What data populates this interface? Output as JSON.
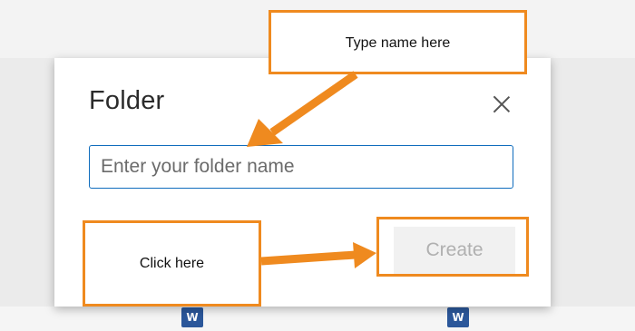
{
  "dialog": {
    "title": "Folder",
    "input_placeholder": "Enter your folder name",
    "input_value": "",
    "create_label": "Create"
  },
  "annotations": {
    "top_callout": "Type name here",
    "left_callout": "Click here"
  },
  "background": {
    "file_icon_letter": "W"
  },
  "colors": {
    "annotation_orange": "#ef8a1f",
    "input_border": "#0f6cbd",
    "word_blue": "#2b579a"
  }
}
